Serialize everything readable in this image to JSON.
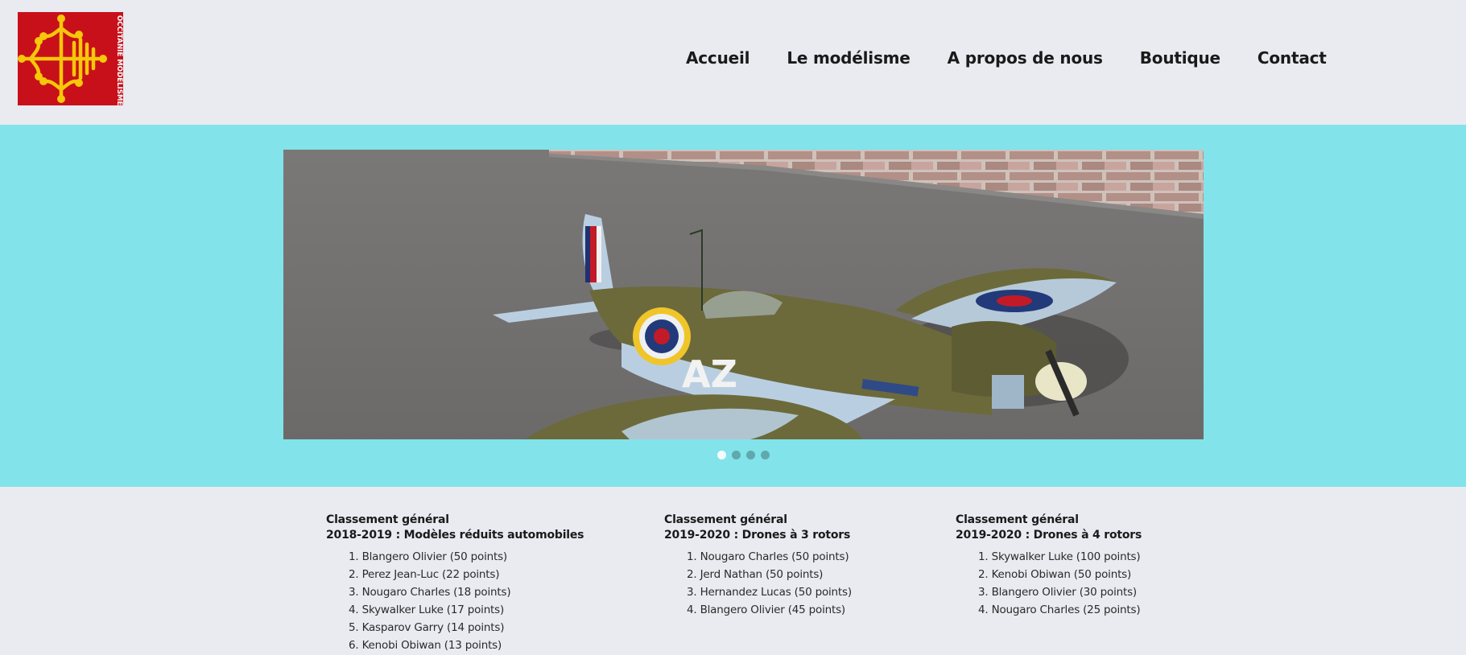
{
  "brand": {
    "logo_text": "OCCITANIE MODELISME",
    "logo_bg": "#c8101a",
    "logo_fg": "#f6c70a"
  },
  "nav": {
    "items": [
      "Accueil",
      "Le modélisme",
      "A propos de nous",
      "Boutique",
      "Contact"
    ]
  },
  "slider": {
    "band_color": "#82e3ea",
    "slide_count": 4,
    "active_index": 0,
    "slide_subject": "Spitfire RC model airplane photo",
    "aircraft_code": "AZ"
  },
  "rankings": [
    {
      "title": "Classement général",
      "subtitle": "2018-2019 : Modèles réduits automobiles",
      "entries": [
        "1. Blangero Olivier (50 points)",
        "2. Perez Jean-Luc (22 points)",
        "3. Nougaro Charles (18 points)",
        "4. Skywalker Luke (17 points)",
        "5. Kasparov Garry (14 points)",
        "6. Kenobi Obiwan (13 points)"
      ]
    },
    {
      "title": "Classement général",
      "subtitle": "2019-2020 : Drones à 3 rotors",
      "entries": [
        "1. Nougaro Charles (50 points)",
        "2. Jerd Nathan (50 points)",
        "3. Hernandez Lucas (50 points)",
        "4. Blangero Olivier (45 points)"
      ]
    },
    {
      "title": "Classement général",
      "subtitle": "2019-2020 : Drones à 4 rotors",
      "entries": [
        "1. Skywalker Luke (100 points)",
        "2. Kenobi Obiwan (50 points)",
        "3. Blangero Olivier (30 points)",
        "4. Nougaro Charles (25 points)"
      ]
    }
  ]
}
